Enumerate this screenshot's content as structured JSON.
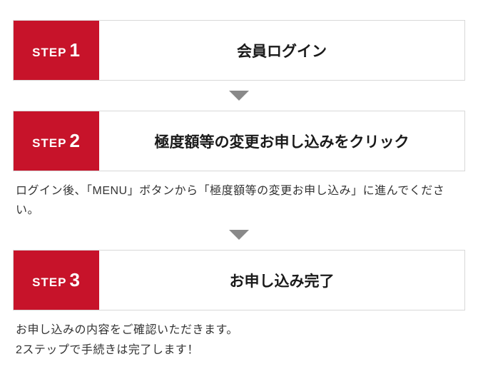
{
  "stepWord": "STEP",
  "steps": [
    {
      "num": "1",
      "title": "会員ログイン",
      "desc": ""
    },
    {
      "num": "2",
      "title": "極度額等の変更お申し込みをクリック",
      "desc": "ログイン後、「MENU」ボタンから「極度額等の変更お申し込み」に進んでください。"
    },
    {
      "num": "3",
      "title": "お申し込み完了",
      "desc": "お申し込みの内容をご確認いただきます。\n2ステップで手続きは完了します！"
    }
  ]
}
